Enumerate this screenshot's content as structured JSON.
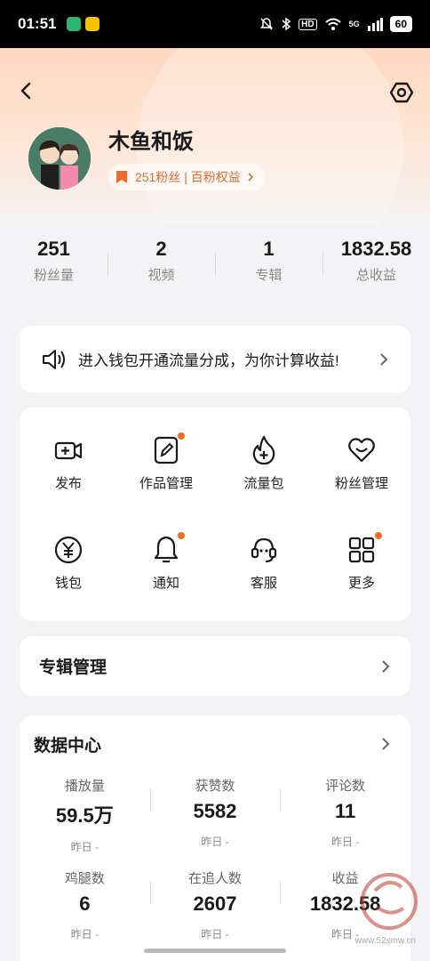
{
  "status": {
    "time": "01:51",
    "signal": "5G",
    "hd": "HD",
    "battery": "60"
  },
  "profile": {
    "name": "木鱼和饭",
    "fans_pill": "251粉丝 | 百粉权益"
  },
  "stats": [
    {
      "value": "251",
      "label": "粉丝量"
    },
    {
      "value": "2",
      "label": "视频"
    },
    {
      "value": "1",
      "label": "专辑"
    },
    {
      "value": "1832.58",
      "label": "总收益"
    }
  ],
  "notice": {
    "text": "进入钱包开通流量分成，为你计算收益!"
  },
  "tools": [
    {
      "label": "发布",
      "icon": "video-camera-plus-icon",
      "dot": false
    },
    {
      "label": "作品管理",
      "icon": "edit-doc-icon",
      "dot": true
    },
    {
      "label": "流量包",
      "icon": "flame-plus-icon",
      "dot": false
    },
    {
      "label": "粉丝管理",
      "icon": "heart-icon",
      "dot": false
    },
    {
      "label": "钱包",
      "icon": "yuan-coin-icon",
      "dot": false
    },
    {
      "label": "通知",
      "icon": "bell-icon",
      "dot": true
    },
    {
      "label": "客服",
      "icon": "headset-icon",
      "dot": false
    },
    {
      "label": "更多",
      "icon": "grid-icon",
      "dot": true
    }
  ],
  "album": {
    "title": "专辑管理"
  },
  "data_center": {
    "title": "数据中心",
    "items": [
      {
        "label": "播放量",
        "value": "59.5万",
        "yesterday": "昨日 -"
      },
      {
        "label": "获赞数",
        "value": "5582",
        "yesterday": "昨日 -"
      },
      {
        "label": "评论数",
        "value": "11",
        "yesterday": "昨日 -"
      },
      {
        "label": "鸡腿数",
        "value": "6",
        "yesterday": "昨日 -"
      },
      {
        "label": "在追人数",
        "value": "2607",
        "yesterday": "昨日 -"
      },
      {
        "label": "收益",
        "value": "1832.58",
        "yesterday": "昨日 -"
      }
    ]
  },
  "watermark": {
    "url": "www.52smw.cn"
  },
  "colors": {
    "accent": "#f06a2b",
    "hero_top": "#ffd8c0",
    "background": "#f3f3f5"
  }
}
